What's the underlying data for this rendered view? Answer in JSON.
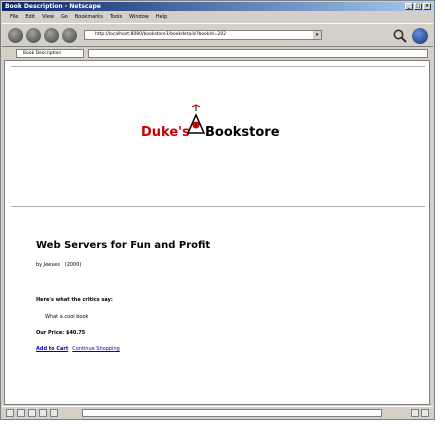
{
  "window": {
    "title": "Book Description - Netscape"
  },
  "menu": [
    "File",
    "Edit",
    "View",
    "Go",
    "Bookmarks",
    "Tools",
    "Window",
    "Help"
  ],
  "toolbar": {
    "url": "http://localhost:8080/bookstore1/bookdetails?bookId=202"
  },
  "tabs": [
    {
      "label": "Book Description"
    }
  ],
  "page": {
    "logo_left": "Duke's",
    "logo_right": "Bookstore",
    "book_title": "Web Servers for Fun and Profit",
    "by_label": "by",
    "author": "Jeeves",
    "year": "(2000)",
    "critics_label": "Here's what the critics say:",
    "review": "What a cool book",
    "price_label": "Our Price:",
    "price": "$40.75",
    "add_to_cart": "Add to Cart",
    "continue_shopping": "Continue Shopping"
  }
}
